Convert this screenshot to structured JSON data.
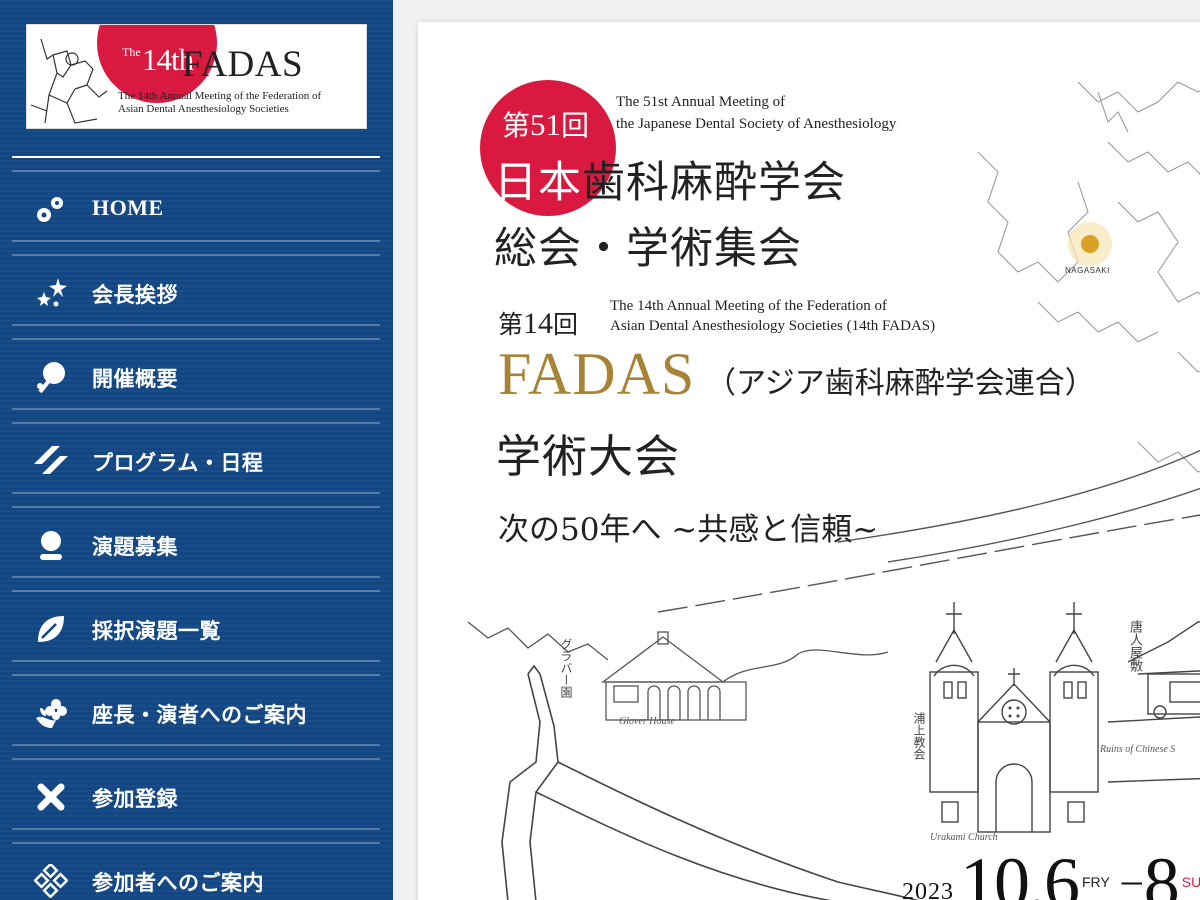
{
  "sidebar": {
    "logo": {
      "the": "The",
      "num": "14th",
      "name": "FADAS",
      "line1": "The 14th Annual Meeting of the Federation of",
      "line2": "Asian Dental Anesthesiology Societies"
    },
    "nav": [
      {
        "label": "HOME",
        "icon": "dots-icon"
      },
      {
        "label": "会長挨拶",
        "icon": "sparkle-icon"
      },
      {
        "label": "開催概要",
        "icon": "balloon-icon"
      },
      {
        "label": "プログラム・日程",
        "icon": "double-slash-icon"
      },
      {
        "label": "演題募集",
        "icon": "person-icon"
      },
      {
        "label": "採択演題一覧",
        "icon": "leaf-icon"
      },
      {
        "label": "座長・演者へのご案内",
        "icon": "flower-icon"
      },
      {
        "label": "参加登録",
        "icon": "cross-icon"
      },
      {
        "label": "参加者へのご案内",
        "icon": "diamonds-icon"
      }
    ]
  },
  "hero": {
    "jdsa": {
      "ordinal_prefix": "第",
      "ordinal_num": "51",
      "ordinal_suffix": "回",
      "en_line1": "The 51st Annual Meeting of",
      "en_line2": "the Japanese Dental Society of Anesthesiology",
      "title_white": "日本",
      "title_rest": "歯科麻酔学会",
      "title_line2": "総会・学術集会"
    },
    "fadas": {
      "ordinal_prefix": "第",
      "ordinal_num": "14",
      "ordinal_suffix": "回",
      "en_line1": "The 14th Annual Meeting of the Federation of",
      "en_line2": "Asian Dental Anesthesiology Societies (14th FADAS)",
      "name": "FADAS",
      "name_sub": "（アジア歯科麻酔学会連合）",
      "title_line2": "学術大会"
    },
    "theme": "次の50年へ ~共感と信頼~",
    "map_label": "NAGASAKI",
    "landmarks": {
      "glover_en": "Glover House",
      "glover_jp": "グラバー園",
      "urakami_en": "Urakami Church",
      "urakami_jp": "浦上教会",
      "tojin_jp": "唐人屋敷",
      "ruins_en": "Ruins of Chinese S"
    },
    "date": {
      "year": "2023",
      "month_day": "10.6",
      "day_start": "FRY",
      "separator": "–",
      "end_day": "8",
      "day_end": "SUN"
    },
    "accent_red": "#d9193f",
    "accent_gold": "#a88336",
    "sidebar_blue": "#124783"
  }
}
